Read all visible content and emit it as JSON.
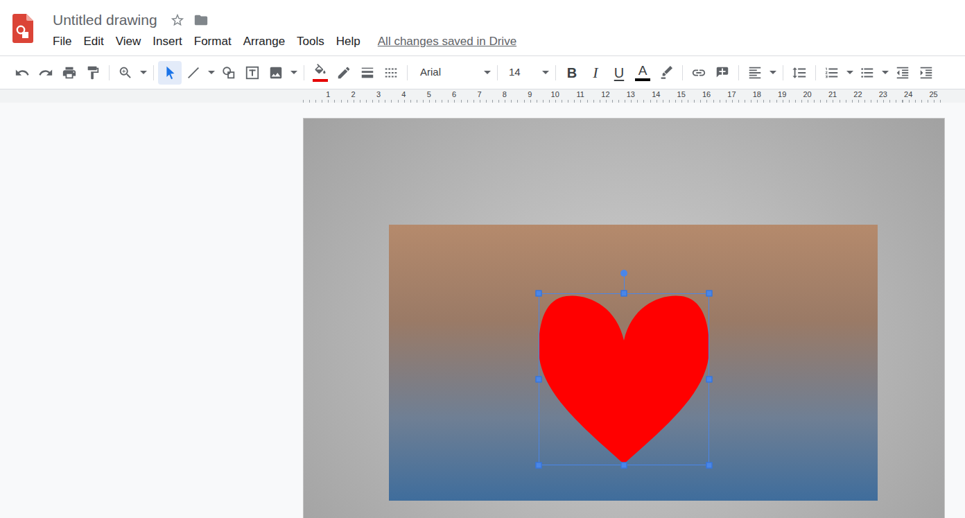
{
  "window": {
    "title": "Untitled drawing",
    "starred": false
  },
  "menu": [
    "File",
    "Edit",
    "View",
    "Insert",
    "Format",
    "Arrange",
    "Tools",
    "Help"
  ],
  "save_status": "All changes saved in Drive",
  "toolbar": {
    "groups": [
      [
        {
          "kind": "undo",
          "dropdown": false,
          "selected": false
        },
        {
          "kind": "redo",
          "dropdown": false,
          "selected": false
        },
        {
          "kind": "print",
          "dropdown": false,
          "selected": false
        },
        {
          "kind": "paint",
          "dropdown": false,
          "selected": false
        }
      ],
      [
        {
          "kind": "zoom",
          "dropdown": true,
          "selected": false
        }
      ],
      [
        {
          "kind": "select",
          "dropdown": false,
          "selected": true
        },
        {
          "kind": "line",
          "dropdown": true,
          "selected": false
        },
        {
          "kind": "shape",
          "dropdown": false,
          "selected": false
        },
        {
          "kind": "textbox",
          "dropdown": false,
          "selected": false
        },
        {
          "kind": "image",
          "dropdown": true,
          "selected": false
        }
      ],
      [
        {
          "kind": "fill",
          "dropdown": false,
          "selected": false,
          "color": "#e50000"
        },
        {
          "kind": "pen",
          "dropdown": false,
          "selected": false
        },
        {
          "kind": "weight",
          "dropdown": false,
          "selected": false
        },
        {
          "kind": "dash",
          "dropdown": false,
          "selected": false
        }
      ],
      [
        {
          "kind": "font",
          "label": "Arial",
          "dropdown": true,
          "selected": false
        }
      ],
      [
        {
          "kind": "size",
          "label": "14",
          "dropdown": true,
          "selected": false
        }
      ],
      [
        {
          "kind": "bold",
          "label": "B",
          "dropdown": false,
          "selected": false
        },
        {
          "kind": "italic",
          "label": "I",
          "dropdown": false,
          "selected": false
        },
        {
          "kind": "underline",
          "label": "U",
          "dropdown": false,
          "selected": false
        },
        {
          "kind": "textcolor",
          "label": "A",
          "dropdown": false,
          "selected": false,
          "color": "#000000"
        },
        {
          "kind": "highlight",
          "dropdown": false,
          "selected": false
        }
      ],
      [
        {
          "kind": "link",
          "dropdown": false,
          "selected": false
        },
        {
          "kind": "comment",
          "dropdown": false,
          "selected": false
        }
      ],
      [
        {
          "kind": "align",
          "dropdown": true,
          "selected": false
        }
      ],
      [
        {
          "kind": "spacing",
          "dropdown": false,
          "selected": false
        }
      ],
      [
        {
          "kind": "numbered",
          "dropdown": true,
          "selected": false
        },
        {
          "kind": "bulleted",
          "dropdown": true,
          "selected": false
        },
        {
          "kind": "outdent",
          "dropdown": false,
          "selected": false
        },
        {
          "kind": "indent",
          "dropdown": false,
          "selected": false
        }
      ]
    ]
  },
  "ruler": [
    "1",
    "2",
    "3",
    "4",
    "5",
    "6",
    "7",
    "8",
    "9",
    "10",
    "11",
    "12",
    "13",
    "14",
    "15",
    "16",
    "17",
    "18",
    "19",
    "20",
    "21",
    "22",
    "23",
    "24",
    "25"
  ],
  "canvas": {
    "shapes": [
      {
        "kind": "image",
        "selected": false
      },
      {
        "kind": "heart",
        "selected": true
      }
    ]
  }
}
